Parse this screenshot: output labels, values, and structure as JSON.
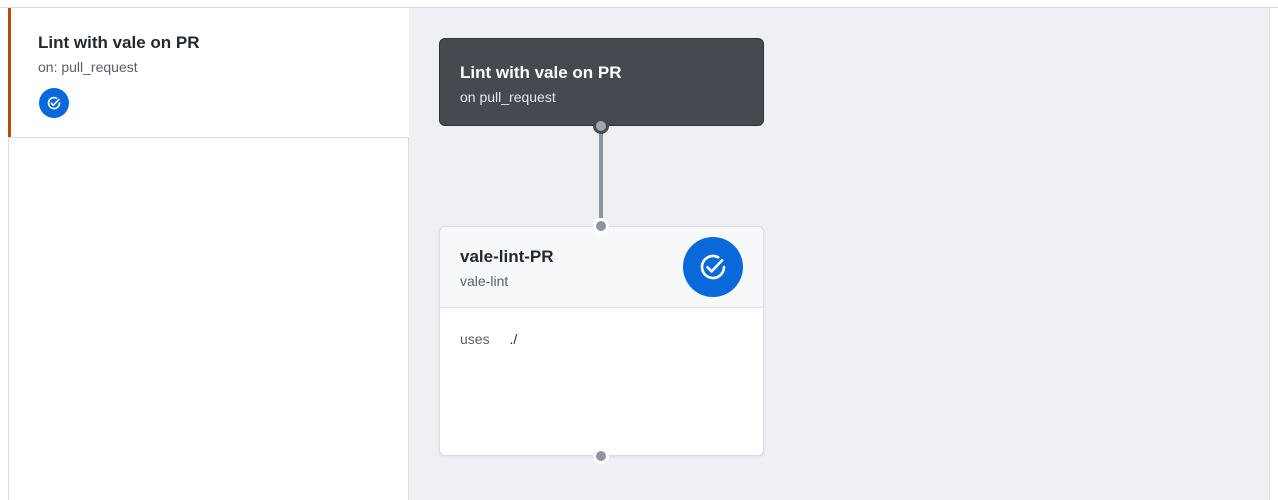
{
  "sidebar": {
    "workflow_title": "Lint with vale on PR",
    "workflow_trigger": "on: pull_request",
    "status_icon": "check-circle-icon",
    "accent_color": "#bc4c00",
    "status_color": "#0969da"
  },
  "graph": {
    "trigger_node": {
      "title": "Lint with vale on PR",
      "subtitle": "on pull_request"
    },
    "job_node": {
      "title": "vale-lint-PR",
      "subtitle": "vale-lint",
      "status_icon": "check-circle-icon",
      "steps": [
        {
          "key": "uses",
          "value": "./"
        }
      ]
    }
  }
}
